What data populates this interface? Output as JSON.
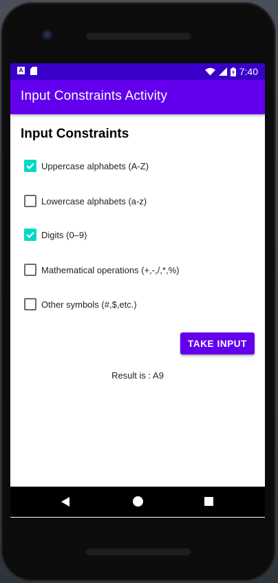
{
  "status_bar": {
    "time": "7:40",
    "left_icons": [
      "notification-a-icon",
      "sd-card-icon"
    ],
    "right_icons": [
      "wifi-icon",
      "cell-signal-icon",
      "battery-charging-icon"
    ]
  },
  "app_bar": {
    "title": "Input Constraints Activity",
    "color": "#6200ee"
  },
  "heading": "Input Constraints",
  "options": [
    {
      "label": "Uppercase alphabets (A-Z)",
      "checked": true
    },
    {
      "label": "Lowercase alphabets (a-z)",
      "checked": false
    },
    {
      "label": "Digits (0–9)",
      "checked": true
    },
    {
      "label": "Mathematical operations (+,-,/,*,%)",
      "checked": false
    },
    {
      "label": "Other symbols (#,$,etc.)",
      "checked": false
    }
  ],
  "button": {
    "label": "TAKE INPUT"
  },
  "result": "Result is : A9",
  "colors": {
    "status_bar": "#3a00c9",
    "accent": "#03dac5",
    "primary": "#6200ee"
  },
  "nav_bar": {
    "icons": [
      "back-icon",
      "home-icon",
      "recents-icon"
    ]
  }
}
